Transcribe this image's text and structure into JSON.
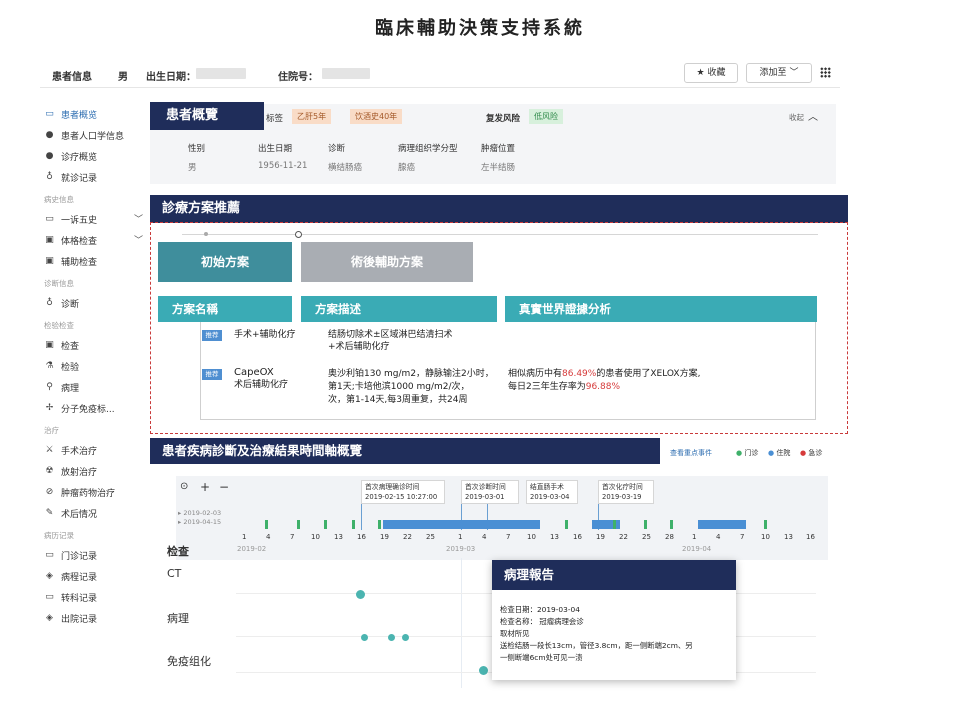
{
  "system_title": "臨床輔助決策支持系統",
  "header": {
    "patient_info_label": "患者信息",
    "gender": "男",
    "birth_label": "出生日期：",
    "hospital_no_label": "住院号：",
    "favorite_button": "收藏",
    "add_to_button": "添加至"
  },
  "sidebar": {
    "items": [
      {
        "label": "患者概览",
        "icon": "folder-icon"
      },
      {
        "label": "患者人口学信息",
        "icon": "person-icon"
      },
      {
        "label": "诊疗概览",
        "icon": "person-icon"
      },
      {
        "label": "就诊记录",
        "icon": "stethoscope-icon"
      },
      {
        "section": "病史信息"
      },
      {
        "label": "一诉五史",
        "icon": "folder-icon"
      },
      {
        "label": "体格检查",
        "icon": "report-icon"
      },
      {
        "label": "辅助检查",
        "icon": "report-icon"
      },
      {
        "section": "诊断信息"
      },
      {
        "label": "诊断",
        "icon": "stethoscope-icon"
      },
      {
        "section": "检验检查"
      },
      {
        "label": "检查",
        "icon": "report-icon"
      },
      {
        "label": "检验",
        "icon": "flask-icon"
      },
      {
        "label": "病理",
        "icon": "microscope-icon"
      },
      {
        "label": "分子免疫标...",
        "icon": "gene-icon"
      },
      {
        "section": "治疗"
      },
      {
        "label": "手术治疗",
        "icon": "scalpel-icon"
      },
      {
        "label": "放射治疗",
        "icon": "radiation-icon"
      },
      {
        "label": "肿瘤药物治疗",
        "icon": "pill-icon"
      },
      {
        "label": "术后情况",
        "icon": "edit-icon"
      },
      {
        "section": "病历记录"
      },
      {
        "label": "门诊记录",
        "icon": "folder-icon"
      },
      {
        "label": "病程记录",
        "icon": "stack-icon"
      },
      {
        "label": "转科记录",
        "icon": "folder-icon"
      },
      {
        "label": "出院记录",
        "icon": "stack-icon"
      }
    ]
  },
  "overview": {
    "title": "患者概覽",
    "tags_label": "标签",
    "tags": [
      "乙肝5年",
      "饮酒史40年"
    ],
    "relapse_label": "复发风险",
    "relapse_value": "低风险",
    "collapse": "收起",
    "fields": [
      {
        "label": "性别",
        "value": "男"
      },
      {
        "label": "出生日期",
        "value": "1956-11-21"
      },
      {
        "label": "诊断",
        "value": "横结肠癌"
      },
      {
        "label": "病理组织学分型",
        "value": "腺癌"
      },
      {
        "label": "肿瘤位置",
        "value": "左半结肠"
      }
    ]
  },
  "plan": {
    "title": "診療方案推薦",
    "tabs": [
      "初始方案",
      "術後輔助方案"
    ],
    "columns": [
      "方案名稱",
      "方案描述",
      "真實世界證據分析"
    ],
    "badge": "推荐",
    "rows": [
      {
        "name": "手术+辅助化疗",
        "desc_1": "结肠切除术±区域淋巴结清扫术",
        "desc_2": "+术后辅助化疗"
      },
      {
        "name_1": "CapeOX",
        "name_2": "术后辅助化疗",
        "desc_1": "奥沙利铂130 mg/m2，静脉输注2小时，",
        "desc_2": "第1天;卡培他滨1000 mg/m2/次，",
        "desc_3": "次，第1-14天,每3周重复，共24周",
        "ev_a": "相似病历中有",
        "ev_pct": "86.49%",
        "ev_b": "的患者使用了XELOX方案,",
        "ev_c": "每日2三年生存率为",
        "ev_surv": "96.88%"
      }
    ]
  },
  "timeline": {
    "title": "患者疾病診斷及治療結果時間軸概覽",
    "view_events": "查看重点事件",
    "legend": [
      "门诊",
      "住院",
      "急诊"
    ],
    "range_start": "2019-02-03",
    "range_end": "2019-04-15",
    "events": [
      {
        "name": "首次病理确诊时间",
        "date": "2019-02-15 10:27:00"
      },
      {
        "name": "首次诊断时间",
        "date": "2019-03-01"
      },
      {
        "name": "结直肠手术",
        "date": "2019-03-04"
      },
      {
        "name": "首次化疗时间",
        "date": "2019-03-19"
      }
    ],
    "ticks": [
      "1",
      "4",
      "7",
      "10",
      "13",
      "16",
      "19",
      "22",
      "25",
      "1",
      "4",
      "7",
      "10",
      "13",
      "16",
      "19",
      "22",
      "25",
      "28",
      "1",
      "4",
      "7",
      "10",
      "13",
      "16"
    ],
    "months": [
      "2019-02",
      "2019-03",
      "2019-04"
    ],
    "rows_header": "检查",
    "rows": [
      "CT",
      "病理",
      "免疫组化"
    ]
  },
  "popup": {
    "title": "病理報告",
    "lines": [
      "检查日期：2019-03-04",
      "检查名称：  冠瘤病理会诊",
      "取材所见",
      "送检结肠一段长13cm，管径3.8cm，距一侧断端2cm、另",
      "一侧断端6cm处可见一溃"
    ]
  }
}
